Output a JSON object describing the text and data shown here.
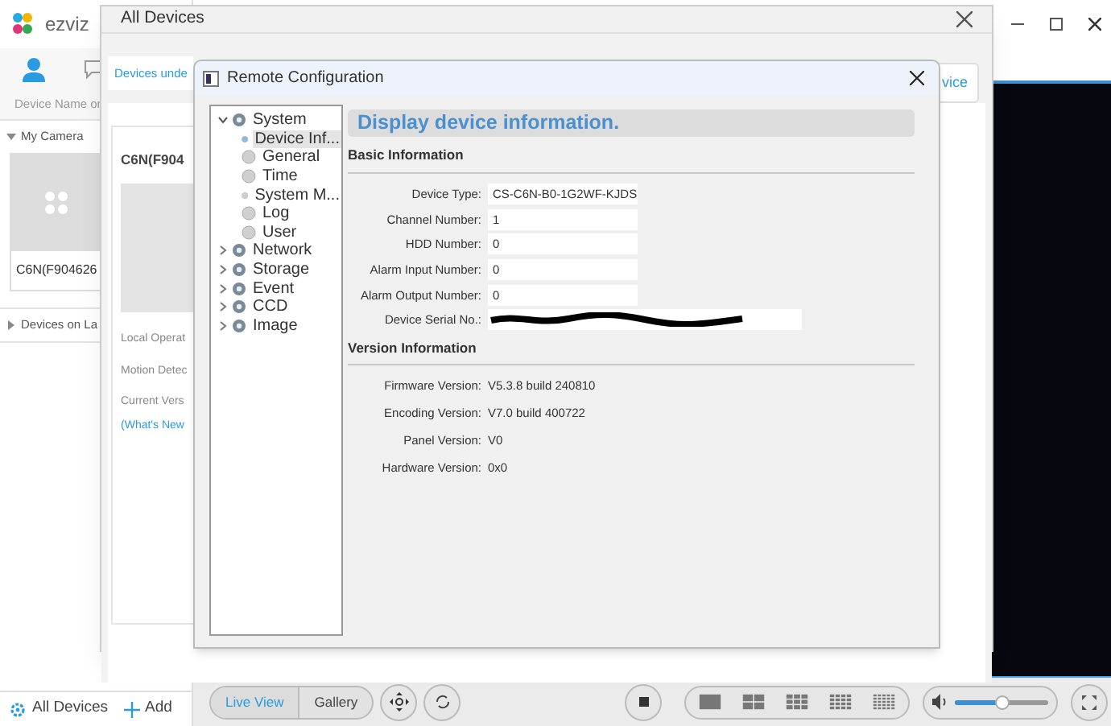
{
  "app": {
    "logo": "ezviz",
    "search": {
      "placeholder": "Device Name or"
    },
    "groups": [
      {
        "label": "My Camera",
        "expanded": true,
        "devices": [
          {
            "name": "C6N(F904626"
          }
        ]
      },
      {
        "label": "Devices on La",
        "expanded": false
      }
    ],
    "footer": {
      "all_devices": "All Devices",
      "add": "Add"
    }
  },
  "toolbar": {
    "views": [
      {
        "label": "Live View",
        "selected": true
      },
      {
        "label": "Gallery",
        "selected": false
      }
    ],
    "volume": {
      "level": 0.5
    }
  },
  "all_devices": {
    "title": "All Devices",
    "tab": "Devices unde",
    "button": "vice",
    "card": {
      "title": "C6N(F904",
      "lines": [
        "Local Operat",
        "Motion Detec",
        "Current Vers"
      ],
      "link": "(What's New"
    }
  },
  "remote_config": {
    "title": "Remote Configuration",
    "heading": "Display device information.",
    "tree": [
      {
        "label": "System",
        "expanded": true,
        "children": [
          {
            "label": "Device Inf...",
            "selected": true
          },
          {
            "label": "General",
            "selected": false
          },
          {
            "label": "Time",
            "selected": false
          },
          {
            "label": "System M...",
            "selected": false
          },
          {
            "label": "Log",
            "selected": false
          },
          {
            "label": "User",
            "selected": false
          }
        ]
      },
      {
        "label": "Network",
        "expanded": false
      },
      {
        "label": "Storage",
        "expanded": false
      },
      {
        "label": "Event",
        "expanded": false
      },
      {
        "label": "CCD",
        "expanded": false
      },
      {
        "label": "Image",
        "expanded": false
      }
    ],
    "sections": [
      {
        "title": "Basic Information",
        "kind": "fields",
        "rows": [
          {
            "label": "Device Type:",
            "value": "CS-C6N-B0-1G2WF-KJDS"
          },
          {
            "label": "Channel Number:",
            "value": "1"
          },
          {
            "label": "HDD Number:",
            "value": "0"
          },
          {
            "label": "Alarm Input Number:",
            "value": "0"
          },
          {
            "label": "Alarm Output Number:",
            "value": "0"
          },
          {
            "label": "Device Serial No.:",
            "redacted": true
          }
        ]
      },
      {
        "title": "Version Information",
        "kind": "values",
        "rows": [
          {
            "label": "Firmware Version:",
            "value": "V5.3.8 build 240810"
          },
          {
            "label": "Encoding Version:",
            "value": "V7.0 build 400722"
          },
          {
            "label": "Panel Version:",
            "value": "V0"
          },
          {
            "label": "Hardware Version:",
            "value": "0x0"
          }
        ]
      }
    ]
  }
}
